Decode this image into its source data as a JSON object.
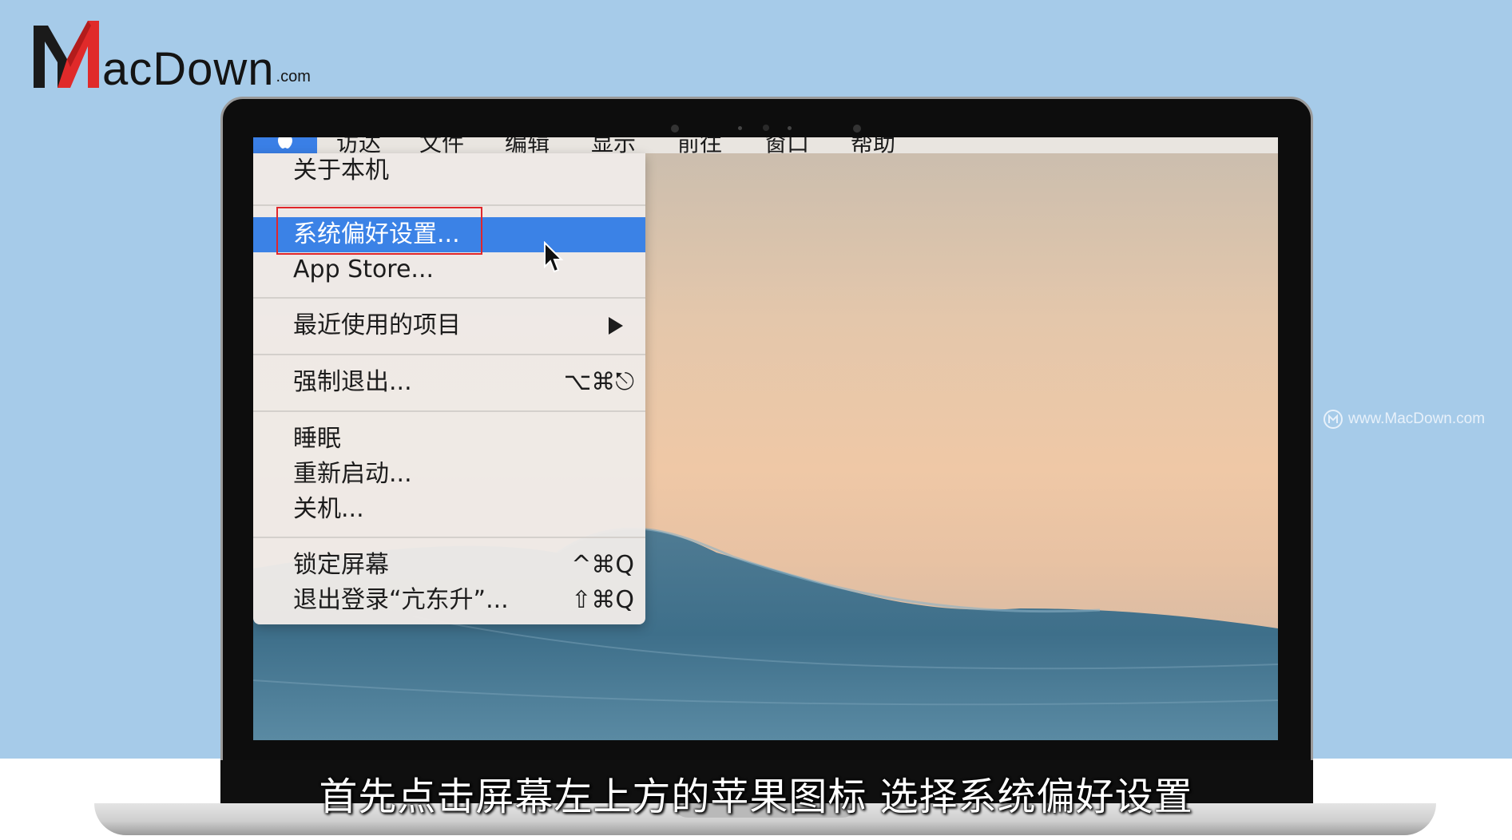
{
  "logo": {
    "text": "acDown",
    "com": ".com"
  },
  "watermark": {
    "text": "www.MacDown.com"
  },
  "menubar": {
    "items": [
      "访达",
      "文件",
      "编辑",
      "显示",
      "前往",
      "窗口",
      "帮助"
    ]
  },
  "apple_menu": {
    "items": [
      {
        "label": "关于本机",
        "shortcut": ""
      },
      {
        "label": "系统偏好设置...",
        "shortcut": "",
        "highlighted": true
      },
      {
        "label": "App Store...",
        "shortcut": ""
      },
      {
        "label": "最近使用的项目",
        "shortcut": "",
        "submenu": true
      },
      {
        "label": "强制退出...",
        "shortcut": "⌥⌘⎋"
      },
      {
        "label": "睡眠",
        "shortcut": ""
      },
      {
        "label": "重新启动...",
        "shortcut": ""
      },
      {
        "label": "关机...",
        "shortcut": ""
      },
      {
        "label": "锁定屏幕",
        "shortcut": "^⌘Q"
      },
      {
        "label": "退出登录“亢东升”...",
        "shortcut": "⇧⌘Q"
      }
    ]
  },
  "subtitle": "首先点击屏幕左上方的苹果图标 选择系统偏好设置",
  "colors": {
    "highlight": "#3b82e6",
    "annotation_box": "#e0262a",
    "background": "#a6cbe9"
  }
}
